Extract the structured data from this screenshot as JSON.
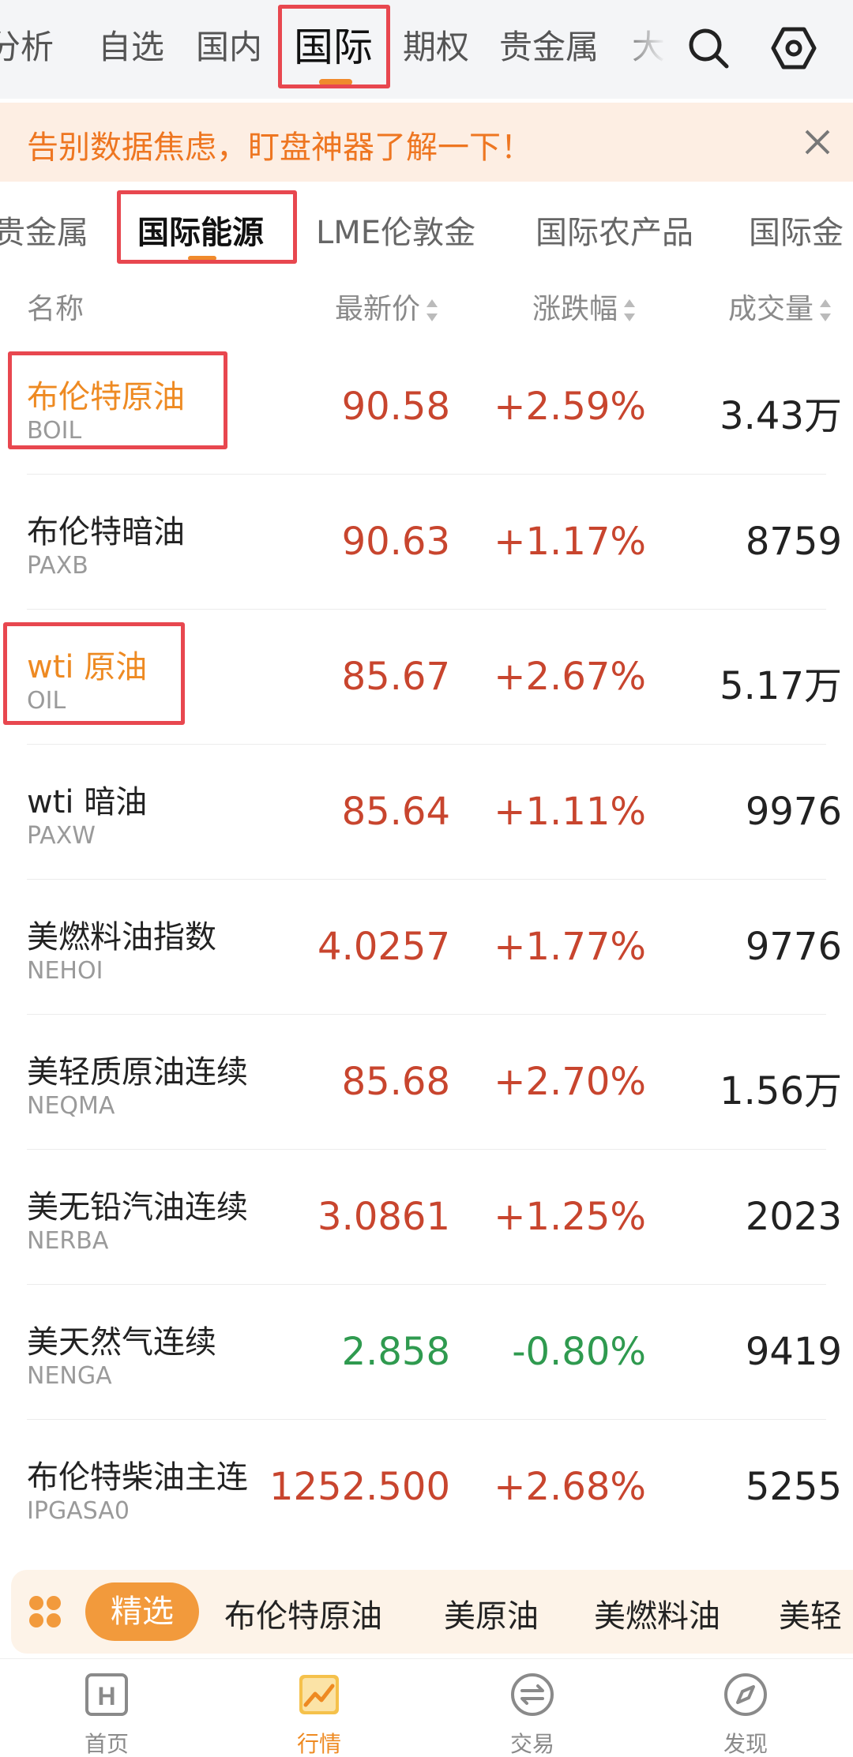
{
  "top_tabs": [
    {
      "label": "分析"
    },
    {
      "label": "自选"
    },
    {
      "label": "国内"
    },
    {
      "label": "国际"
    },
    {
      "label": "期权"
    },
    {
      "label": "贵金属"
    },
    {
      "label": "大"
    }
  ],
  "banner": {
    "text": "告别数据焦虑，盯盘神器了解一下！"
  },
  "sub_tabs": [
    {
      "label": "贵金属"
    },
    {
      "label": "国际能源"
    },
    {
      "label": "LME伦敦金"
    },
    {
      "label": "国际农产品"
    },
    {
      "label": "国际金"
    }
  ],
  "table_header": {
    "name": "名称",
    "price": "最新价",
    "change": "涨跌幅",
    "volume": "成交量"
  },
  "rows": [
    {
      "name": "布伦特原油",
      "code": "BOIL",
      "price": "90.58",
      "change": "+2.59%",
      "volume": "3.43万"
    },
    {
      "name": "布伦特暗油",
      "code": "PAXB",
      "price": "90.63",
      "change": "+1.17%",
      "volume": "8759"
    },
    {
      "name": "wti 原油",
      "code": "OIL",
      "price": "85.67",
      "change": "+2.67%",
      "volume": "5.17万"
    },
    {
      "name": "wti 暗油",
      "code": "PAXW",
      "price": "85.64",
      "change": "+1.11%",
      "volume": "9976"
    },
    {
      "name": "美燃料油指数",
      "code": "NEHOI",
      "price": "4.0257",
      "change": "+1.77%",
      "volume": "9776"
    },
    {
      "name": "美轻质原油连续",
      "code": "NEQMA",
      "price": "85.68",
      "change": "+2.70%",
      "volume": "1.56万"
    },
    {
      "name": "美无铅汽油连续",
      "code": "NERBA",
      "price": "3.0861",
      "change": "+1.25%",
      "volume": "2023"
    },
    {
      "name": "美天然气连续",
      "code": "NENGA",
      "price": "2.858",
      "change": "-0.80%",
      "volume": "9419"
    },
    {
      "name": "布伦特柴油主连",
      "code": "IPGASA0",
      "price": "1252.500",
      "change": "+2.68%",
      "volume": "5255"
    }
  ],
  "quick_bar": {
    "selected_chip": "精选",
    "items": [
      "布伦特原油",
      "美原油",
      "美燃料油",
      "美轻"
    ]
  },
  "bottom_nav": [
    {
      "label": "首页",
      "icon": "home-h-icon"
    },
    {
      "label": "行情",
      "icon": "market-chart-icon"
    },
    {
      "label": "交易",
      "icon": "trade-exchange-icon"
    },
    {
      "label": "发现",
      "icon": "discover-compass-icon"
    }
  ],
  "colors": {
    "accent": "#ee8a22",
    "up": "#c8452e",
    "down": "#2f9a4f",
    "highlight_box": "#e8474f"
  }
}
